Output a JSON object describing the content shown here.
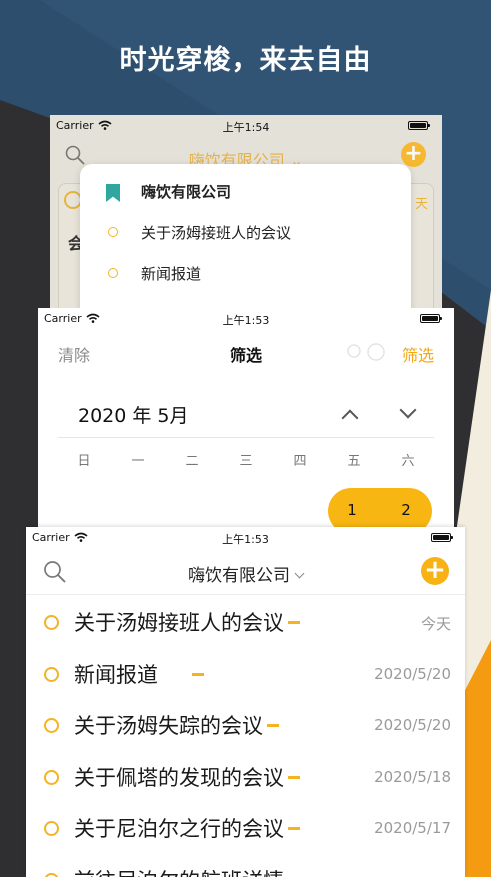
{
  "headline": "时光穿梭，来去自由",
  "colors": {
    "accent": "#f8b213",
    "teal_bookmark": "#2fa7a0",
    "background_dark": "#2f2f31",
    "background_blue": "#2d4f6d"
  },
  "screen_back": {
    "status": {
      "carrier": "Carrier",
      "time": "上午1:54"
    },
    "nav": {
      "title": "嗨饮有限公司 ⌄",
      "add_label": "+"
    },
    "ghost": {
      "today": "天",
      "hui": "会"
    },
    "dropdown": {
      "items": [
        {
          "label": "嗨饮有限公司",
          "icon": "bookmark-icon"
        },
        {
          "label": "关于汤姆接班人的会议",
          "icon": "circle-icon"
        },
        {
          "label": "新闻报道",
          "icon": "circle-icon"
        }
      ]
    }
  },
  "screen_mid": {
    "status": {
      "carrier": "Carrier",
      "time": "上午1:53"
    },
    "nav": {
      "clear_label": "清除",
      "title": "筛选",
      "filter_label": "筛选"
    },
    "month_label": "2020 年 5月",
    "weekdays": [
      "日",
      "一",
      "二",
      "三",
      "四",
      "五",
      "六"
    ],
    "days": [
      "1",
      "2"
    ]
  },
  "screen_front": {
    "status": {
      "carrier": "Carrier",
      "time": "上午1:53"
    },
    "nav": {
      "title": "嗨饮有限公司",
      "add_label": "+"
    },
    "meetings": [
      {
        "title": "关于汤姆接班人的会议",
        "date": "今天"
      },
      {
        "title": "新闻报道",
        "date": "2020/5/20"
      },
      {
        "title": "关于汤姆失踪的会议",
        "date": "2020/5/20"
      },
      {
        "title": "关于佩塔的发现的会议",
        "date": "2020/5/18"
      },
      {
        "title": "关于尼泊尔之行的会议",
        "date": "2020/5/17"
      },
      {
        "title": "前往尼泊尔的航班详情",
        "date": ""
      }
    ]
  }
}
